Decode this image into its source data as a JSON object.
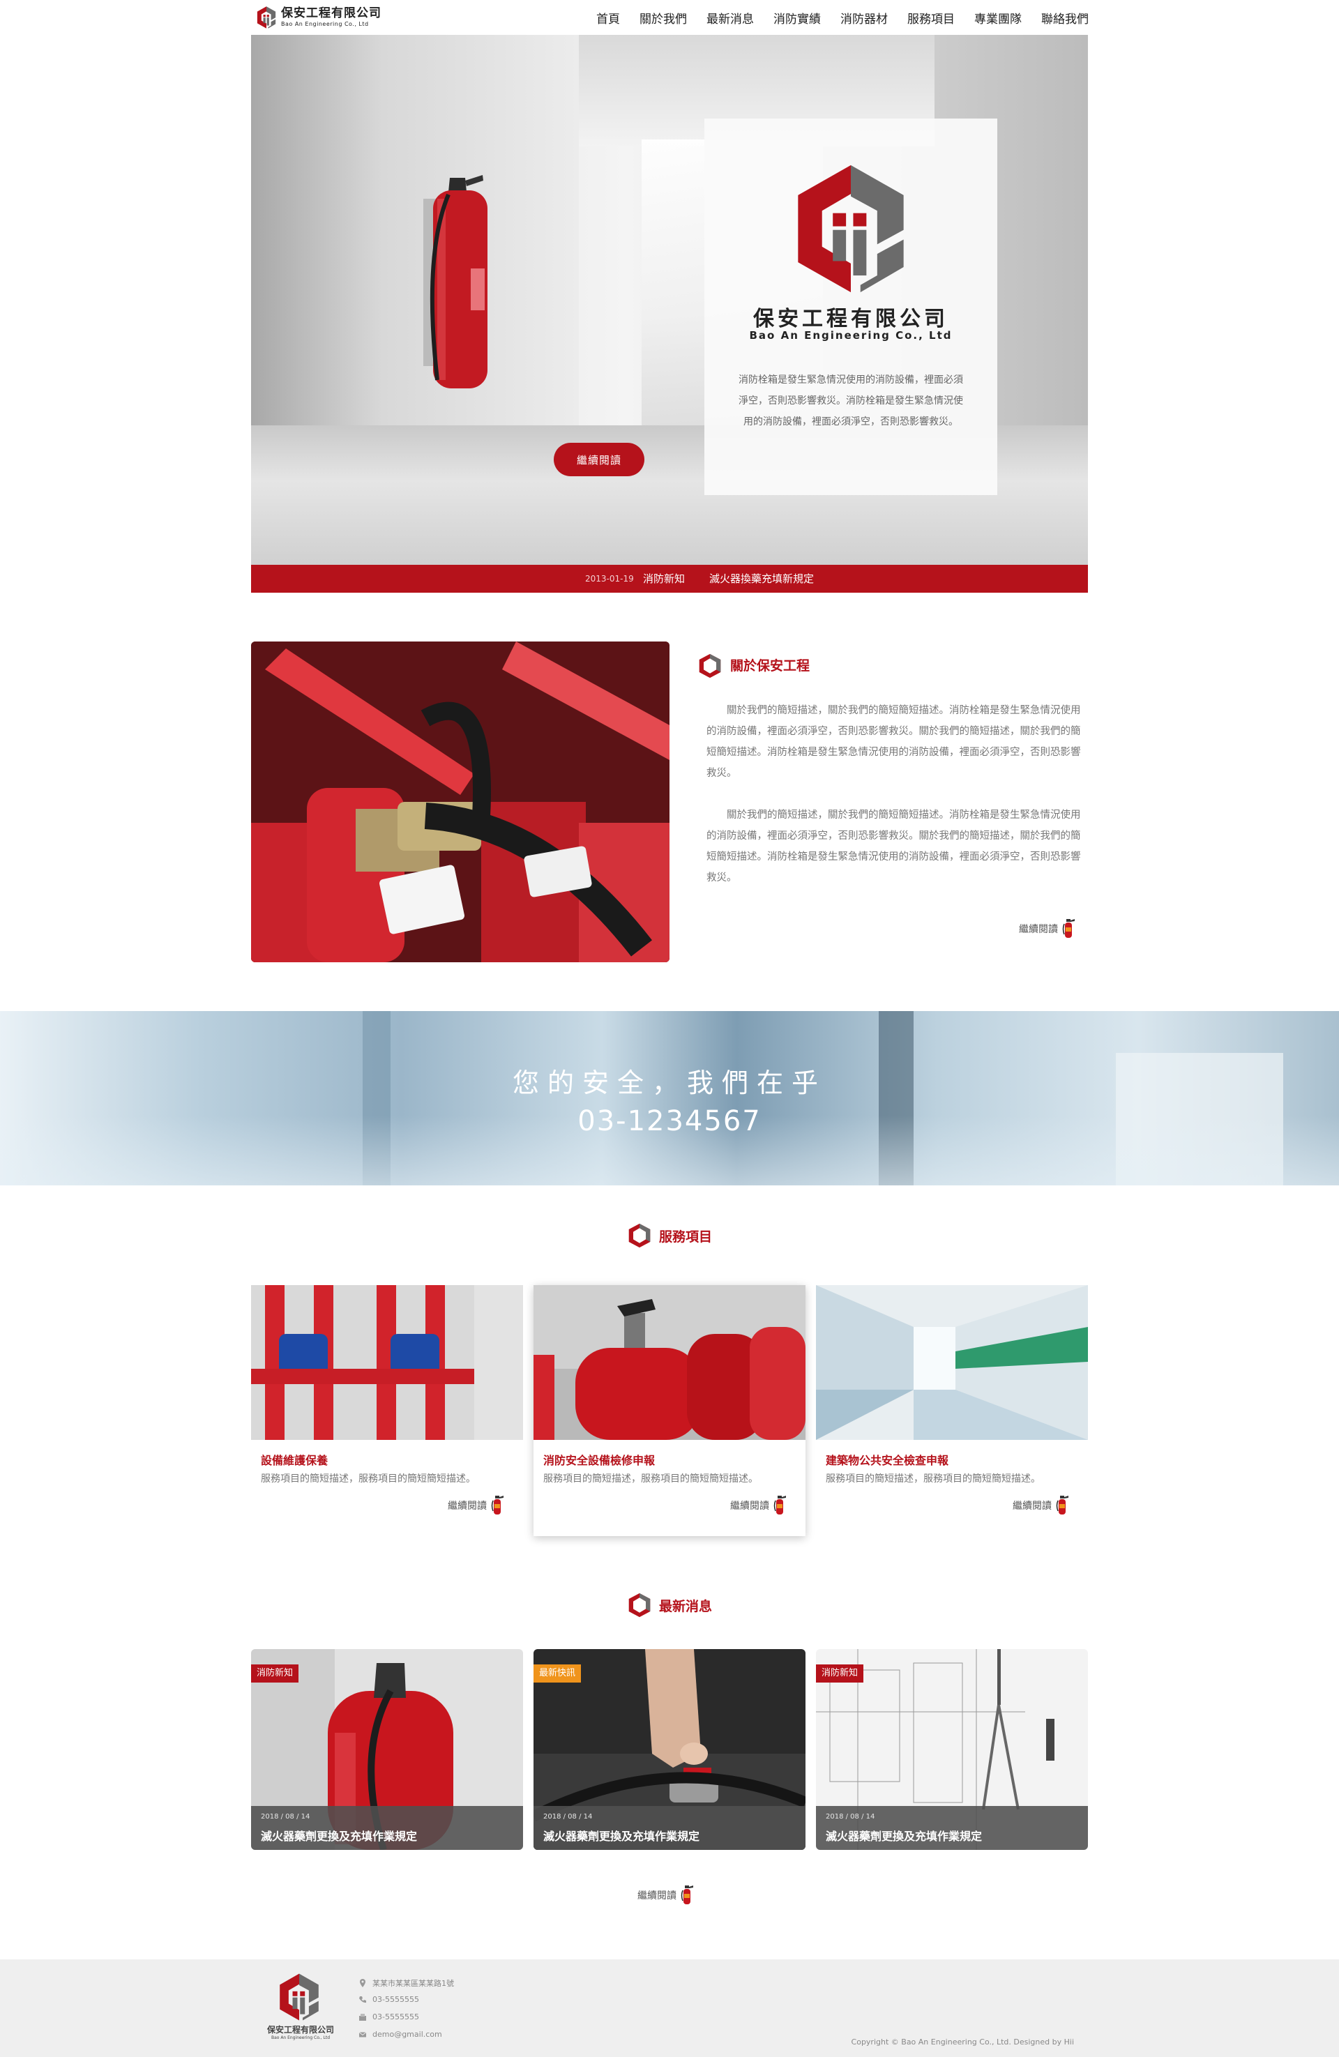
{
  "header": {
    "logo": {
      "name_cn": "保安工程有限公司",
      "name_en": "Bao An Engineering Co., Ltd"
    },
    "nav": [
      {
        "label": "首頁"
      },
      {
        "label": "關於我們"
      },
      {
        "label": "最新消息"
      },
      {
        "label": "消防實績"
      },
      {
        "label": "消防器材"
      },
      {
        "label": "服務項目"
      },
      {
        "label": "專業團隊"
      },
      {
        "label": "聯絡我們"
      }
    ]
  },
  "hero": {
    "company_cn": "保安工程有限公司",
    "company_en": "Bao An Engineering Co., Ltd",
    "text": "消防栓箱是發生緊急情況使用的消防設備，裡面必須淨空，否則恐影響救災。消防栓箱是發生緊急情況使用的消防設備，裡面必須淨空，否則恐影響救災。",
    "button_label": "繼續閱讀"
  },
  "ticker": {
    "date": "2013-01-19",
    "category": "消防新知",
    "title": "滅火器換藥充填新規定"
  },
  "about": {
    "title": "關於保安工程",
    "paragraphs": [
      "關於我們的簡短描述，關於我們的簡短簡短描述。消防栓箱是發生緊急情況使用的消防設備，裡面必須淨空，否則恐影響救災。關於我們的簡短描述，關於我們的簡短簡短描述。消防栓箱是發生緊急情況使用的消防設備，裡面必須淨空，否則恐影響救災。",
      "關於我們的簡短描述，關於我們的簡短簡短描述。消防栓箱是發生緊急情況使用的消防設備，裡面必須淨空，否則恐影響救災。關於我們的簡短描述，關於我們的簡短簡短描述。消防栓箱是發生緊急情況使用的消防設備，裡面必須淨空，否則恐影響救災。"
    ],
    "more_label": "繼續閱讀"
  },
  "banner": {
    "slogan": "您的安全，我們在乎",
    "phone": "03-1234567"
  },
  "services": {
    "title": "服務項目",
    "items": [
      {
        "title": "設備維護保養",
        "desc": "服務項目的簡短描述，服務項目的簡短簡短描述。",
        "more_label": "繼續閱讀"
      },
      {
        "title": "消防安全設備檢修申報",
        "desc": "服務項目的簡短描述，服務項目的簡短簡短描述。",
        "more_label": "繼續閱讀"
      },
      {
        "title": "建築物公共安全檢查申報",
        "desc": "服務項目的簡短描述，服務項目的簡短簡短描述。",
        "more_label": "繼續閱讀"
      }
    ]
  },
  "news": {
    "title": "最新消息",
    "items": [
      {
        "badge": "消防新知",
        "badge_color": "#b5121b",
        "date": "2018 / 08 / 14",
        "title": "滅火器藥劑更換及充填作業規定"
      },
      {
        "badge": "最新快訊",
        "badge_color": "#f0941c",
        "date": "2018 / 08 / 14",
        "title": "滅火器藥劑更換及充填作業規定"
      },
      {
        "badge": "消防新知",
        "badge_color": "#b5121b",
        "date": "2018 / 08 / 14",
        "title": "滅火器藥劑更換及充填作業規定"
      }
    ],
    "more_label": "繼續閱讀"
  },
  "footer": {
    "logo_cn": "保安工程有限公司",
    "logo_en": "Bao An Engineering Co., Ltd",
    "contacts": [
      {
        "icon": "location-pin-icon",
        "text": "某某市某某區某某路1號"
      },
      {
        "icon": "phone-icon",
        "text": "03-5555555"
      },
      {
        "icon": "fax-icon",
        "text": "03-5555555"
      },
      {
        "icon": "mail-icon",
        "text": "demo@gmail.com"
      }
    ],
    "copyright": "Copyright © Bao An Engineering Co., Ltd. Designed by Hii"
  },
  "colors": {
    "brand_red": "#b5121b",
    "accent_orange": "#f0941c",
    "logo_gray": "#6b6b6b"
  }
}
